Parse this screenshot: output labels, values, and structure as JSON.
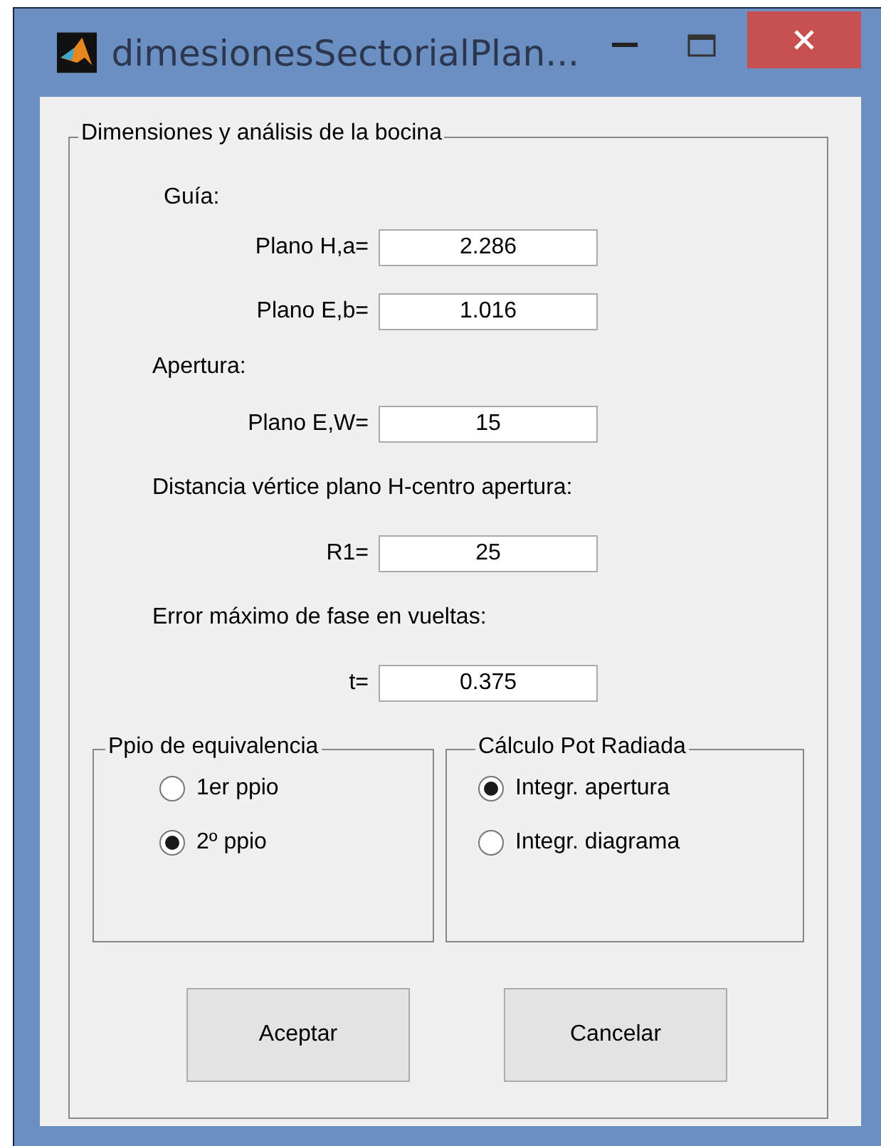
{
  "window": {
    "title": "dimesionesSectorialPlan..."
  },
  "panel": {
    "title": "Dimensiones y análisis de la bocina",
    "items": [
      {
        "kind": "heading",
        "text": "Guía:"
      },
      {
        "kind": "field",
        "label": "Plano H,a=",
        "value": "2.286"
      },
      {
        "kind": "field",
        "label": "Plano E,b=",
        "value": "1.016"
      },
      {
        "kind": "heading",
        "text": "Apertura:"
      },
      {
        "kind": "field",
        "label": "Plano E,W=",
        "value": "15"
      },
      {
        "kind": "caption",
        "text": "Distancia vértice plano H-centro apertura:"
      },
      {
        "kind": "field",
        "label": "R1=",
        "value": "25"
      },
      {
        "kind": "caption",
        "text": "Error máximo de fase en vueltas:"
      },
      {
        "kind": "field",
        "label": "t=",
        "value": "0.375"
      }
    ]
  },
  "groups": [
    {
      "title": "Ppio de equivalencia",
      "options": [
        {
          "label": "1er ppio",
          "selected": false
        },
        {
          "label": "2º ppio",
          "selected": true
        }
      ]
    },
    {
      "title": "Cálculo Pot Radiada",
      "options": [
        {
          "label": "Integr. apertura",
          "selected": true
        },
        {
          "label": "Integr. diagrama",
          "selected": false
        }
      ]
    }
  ],
  "buttons": [
    "Aceptar",
    "Cancelar"
  ]
}
